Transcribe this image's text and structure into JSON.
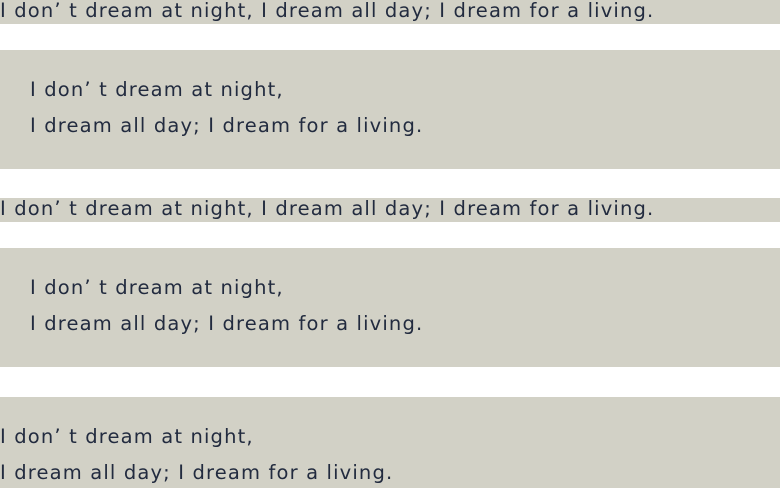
{
  "block1": {
    "line": "I don’ t dream at night, I dream all day; I dream for a living."
  },
  "block2": {
    "line1": "I don’ t dream at night,",
    "line2": "I dream all day; I dream for a living."
  },
  "block3": {
    "line": "I don’ t dream at night, I dream all day; I dream for a living."
  },
  "block4": {
    "line1": "I don’ t dream at night,",
    "line2": "I dream all day; I dream for a living."
  },
  "block5": {
    "line1": "I don’ t dream at night,",
    "line2": "I dream all day; I dream for a living."
  },
  "colors": {
    "background": "#ffffff",
    "block_background": "#d2d1c6",
    "text": "#222b3f"
  }
}
